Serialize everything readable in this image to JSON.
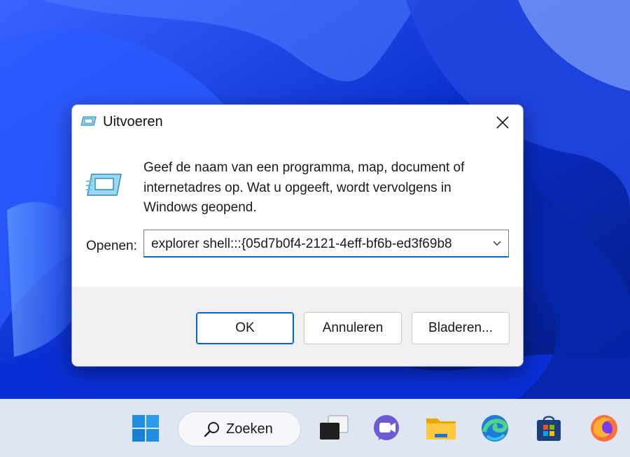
{
  "dialog": {
    "title": "Uitvoeren",
    "description": "Geef de naam van een programma, map, document of internetadres op. Wat u opgeeft, wordt vervolgens in Windows geopend.",
    "open_label": "Openen:",
    "open_value": "explorer shell:::{05d7b0f4-2121-4eff-bf6b-ed3f69b8",
    "buttons": {
      "ok": "OK",
      "cancel": "Annuleren",
      "browse": "Bladeren..."
    }
  },
  "taskbar": {
    "search_label": "Zoeken",
    "icons": [
      "windows-start-icon",
      "search-icon",
      "task-view-icon",
      "teams-chat-icon",
      "file-explorer-icon",
      "edge-icon",
      "microsoft-store-icon",
      "firefox-icon"
    ]
  },
  "colors": {
    "accent": "#0067c0",
    "wallpaper": "#0b2fb3",
    "taskbar": "#dfe5f1"
  }
}
